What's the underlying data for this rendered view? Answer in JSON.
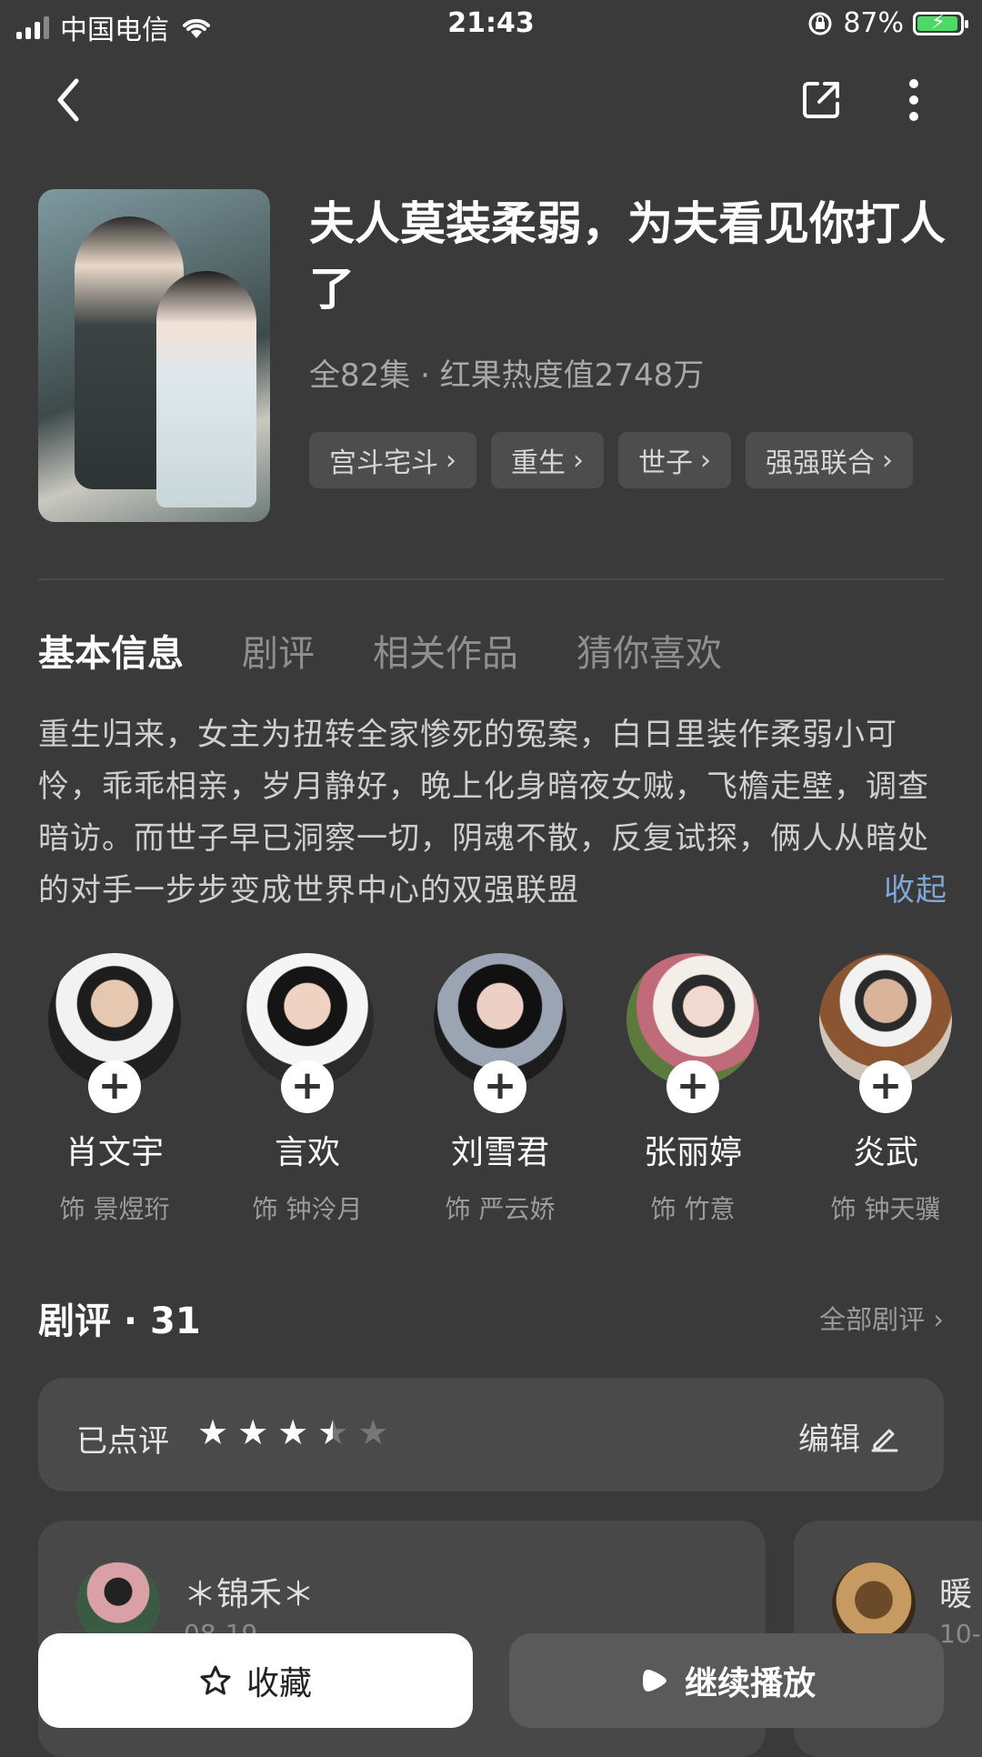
{
  "status": {
    "carrier": "中国电信",
    "time": "21:43",
    "battery": "87%"
  },
  "show": {
    "title": "夫人莫装柔弱，为夫看见你打人了",
    "meta": "全82集 · 红果热度值2748万",
    "tags": [
      "宫斗宅斗",
      "重生",
      "世子",
      "强强联合"
    ]
  },
  "tabs": [
    "基本信息",
    "剧评",
    "相关作品",
    "猜你喜欢"
  ],
  "description": "重生归来，女主为扭转全家惨死的冤案，白日里装作柔弱小可怜，乖乖相亲，岁月静好，晚上化身暗夜女贼，飞檐走壁，调查暗访。而世子早已洞察一切，阴魂不散，反复试探，俩人从暗处的对手一步步变成世界中心的双强联盟",
  "collapse_label": "收起",
  "cast": [
    {
      "name": "肖文宇",
      "role": "饰 景煜珩"
    },
    {
      "name": "言欢",
      "role": "饰 钟泠月"
    },
    {
      "name": "刘雪君",
      "role": "饰 严云娇"
    },
    {
      "name": "张丽婷",
      "role": "饰 竹意"
    },
    {
      "name": "炎武",
      "role": "饰 钟天骥"
    }
  ],
  "reviews": {
    "heading": "剧评 · 31",
    "all_label": "全部剧评 ›",
    "rated_label": "已点评",
    "rating": 3.5,
    "edit_label": "编辑",
    "cards": [
      {
        "name": "＊锦禾＊",
        "date": "08-19"
      },
      {
        "name": "暖",
        "date": "10-"
      }
    ]
  },
  "buttons": {
    "favorite": "收藏",
    "play": "继续播放"
  },
  "colors": {
    "background": "#3a3a3a",
    "link": "#7ea7d8",
    "battery": "#4cd964"
  }
}
